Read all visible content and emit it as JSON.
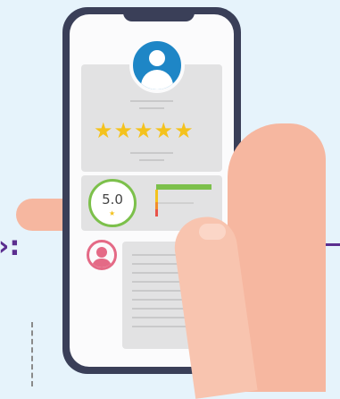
{
  "rating": {
    "value": "5.0",
    "star_icon": "star-icon",
    "star_glyph": "★"
  },
  "profile": {
    "stars_glyphs": "★★★★★",
    "star_count": 5,
    "avatar_icon": "user-avatar-icon"
  },
  "review": {
    "avatar_icon": "reviewer-avatar-icon"
  },
  "decor": {
    "arrow_glyph": "›:"
  },
  "colors": {
    "background": "#e6f3fb",
    "phone": "#3a3f58",
    "avatar_blue": "#1e86c6",
    "star_yellow": "#f4c21d",
    "rating_green": "#7cc04b",
    "reviewer_pink": "#e46a86",
    "skin": "#f6b7a0",
    "accent_purple": "#5b2e8f"
  }
}
